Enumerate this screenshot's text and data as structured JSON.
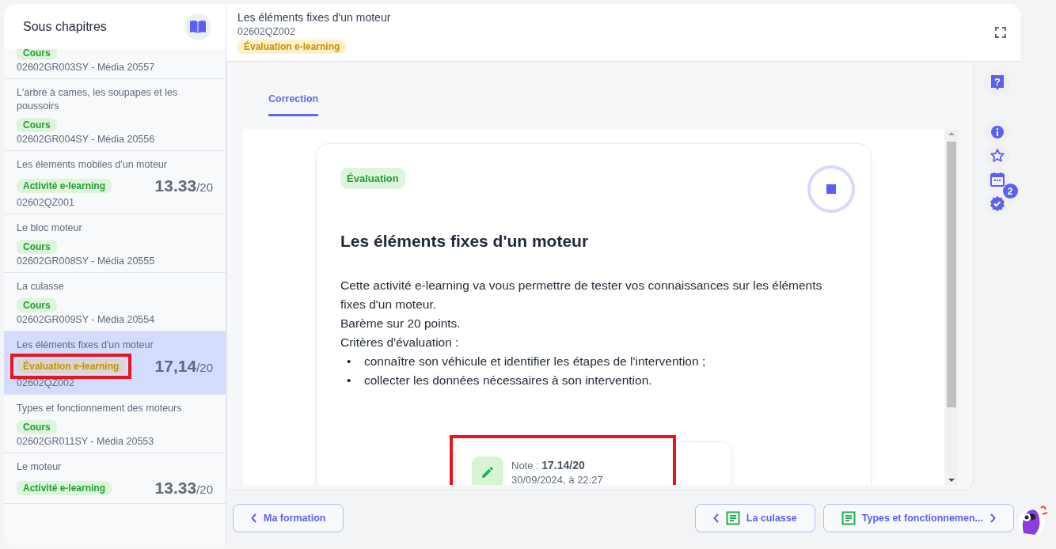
{
  "sidebar": {
    "title": "Sous chapitres",
    "items": [
      {
        "tag": {
          "label": "Cours",
          "kind": "course"
        },
        "code": "02602GR003SY - Média 20557",
        "selected": false
      },
      {
        "title": "L'arbre à cames, les soupapes et les poussoirs",
        "tag": {
          "label": "Cours",
          "kind": "course"
        },
        "code": "02602GR004SY - Média 20556",
        "selected": false
      },
      {
        "title": "Les élements mobiles d'un moteur",
        "tag": {
          "label": "Activité e-learning",
          "kind": "activity"
        },
        "score": "13.33",
        "max": "/20",
        "code": "02602QZ001",
        "selected": false
      },
      {
        "title": "Le bloc moteur",
        "tag": {
          "label": "Cours",
          "kind": "course"
        },
        "code": "02602GR008SY - Média 20555",
        "selected": false
      },
      {
        "title": "La culasse",
        "tag": {
          "label": "Cours",
          "kind": "course"
        },
        "code": "02602GR009SY - Média 20554",
        "selected": false
      },
      {
        "title": "Les éléments fixes d'un moteur",
        "tag": {
          "label": "Évaluation e-learning",
          "kind": "evaluation",
          "highlighted": true
        },
        "score": "17,14",
        "max": "/20",
        "code": "02602QZ002",
        "selected": true
      },
      {
        "title": "Types et fonctionnement des moteurs",
        "tag": {
          "label": "Cours",
          "kind": "course"
        },
        "code": "02602GR011SY - Média 20553",
        "selected": false
      },
      {
        "title": "Le moteur",
        "tag": {
          "label": "Activité e-learning",
          "kind": "activity"
        },
        "score": "13.33",
        "max": "/20",
        "selected": false
      }
    ]
  },
  "header": {
    "title": "Les éléments fixes d'un moteur",
    "code": "02602QZ002",
    "tag": {
      "label": "Évaluation e-learning",
      "kind": "evaluation"
    }
  },
  "tabs": [
    {
      "label": "Correction",
      "selected": true
    }
  ],
  "card": {
    "tag": {
      "label": "Évaluation",
      "kind": "course"
    },
    "title": "Les éléments fixes d'un moteur",
    "paragraphs": [
      "Cette activité e-learning va vous permettre de tester vos connaissances sur les éléments fixes d'un moteur.",
      "Barème sur 20 points.",
      "Critères d'évaluation :"
    ],
    "criteria": [
      {
        "bullet": "•",
        "text": "connaître son véhicule et identifier les étapes de l'intervention ;"
      },
      {
        "bullet": "•",
        "text": "collecter les données nécessaires à son intervention."
      }
    ]
  },
  "note": {
    "score": "Note : **17.14/20**",
    "date": "30/09/2024, à 22:27",
    "highlighted": true
  },
  "rail": {
    "help_glyph": "?",
    "badge_count": "2"
  },
  "footer": {
    "back": "Ma formation",
    "prev": "La culasse",
    "next": "Types et fonctionnemen..."
  }
}
